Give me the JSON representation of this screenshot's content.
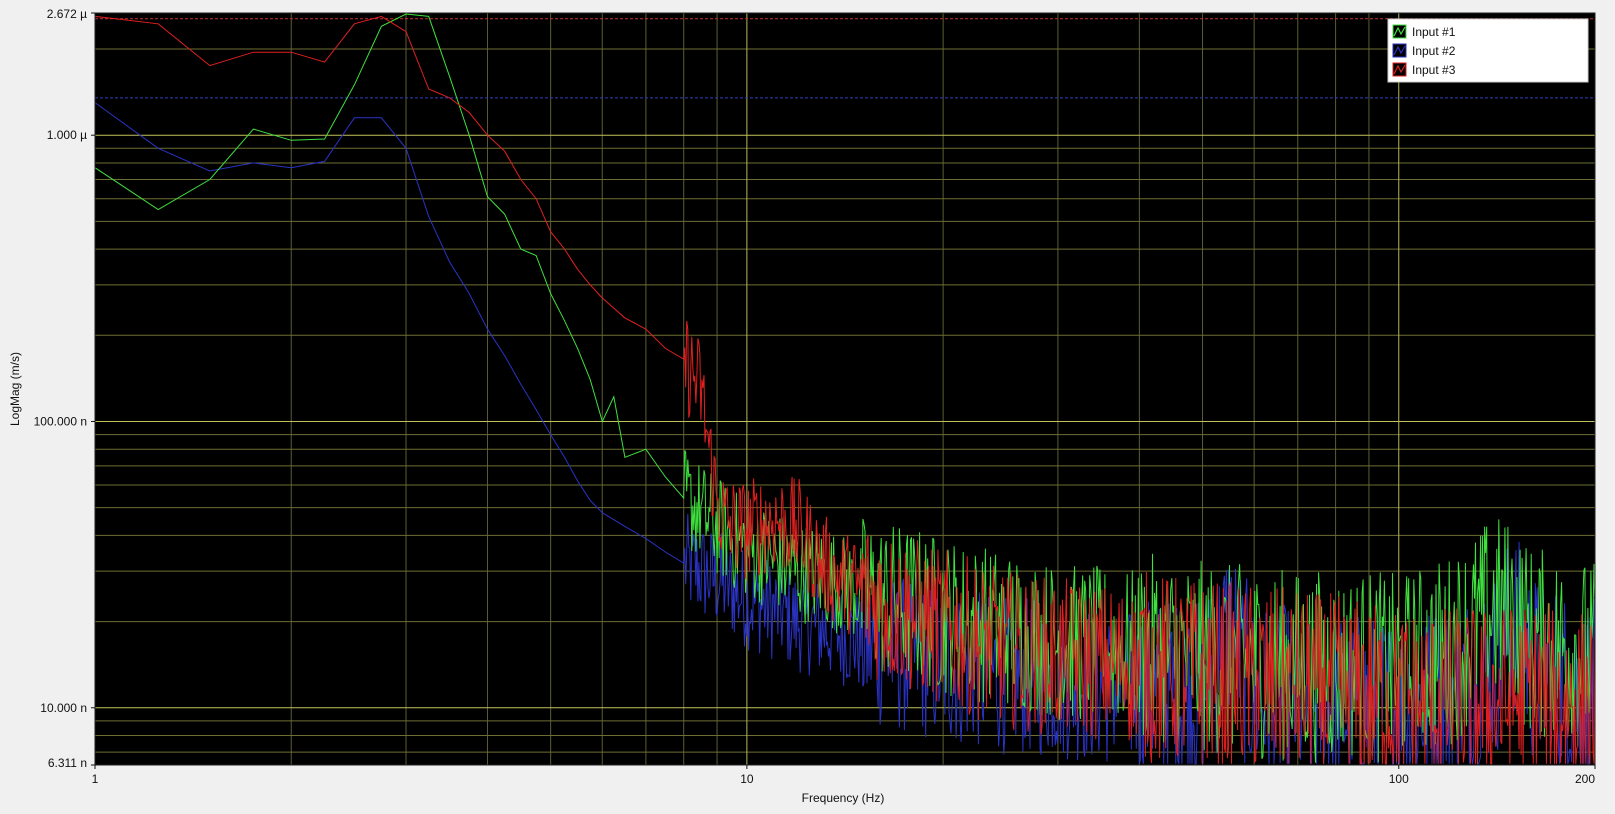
{
  "chart_data": {
    "type": "line",
    "title": "",
    "xlabel": "Frequency (Hz)",
    "ylabel": "LogMag (m/s)",
    "x_scale": "log",
    "y_scale": "log",
    "xlim": [
      1,
      200
    ],
    "ylim": [
      6.311e-09,
      2.672e-06
    ],
    "grid": true,
    "legend_position": "top-right",
    "background": "#000000",
    "x_ticks": [
      {
        "value": 1,
        "label": "1"
      },
      {
        "value": 10,
        "label": "10"
      },
      {
        "value": 100,
        "label": "100"
      },
      {
        "value": 200,
        "label": "200"
      }
    ],
    "y_ticks": [
      {
        "value": 2.672e-06,
        "label": "2.672 µ"
      },
      {
        "value": 1e-06,
        "label": "1.000 µ"
      },
      {
        "value": 1e-07,
        "label": "100.000 n"
      },
      {
        "value": 1e-08,
        "label": "10.000 n"
      },
      {
        "value": 6.311e-09,
        "label": "6.311 n"
      }
    ],
    "reference_lines": [
      {
        "color": "#c83030",
        "value": 2.55e-06
      },
      {
        "color": "#3040c0",
        "value": 1.35e-06
      }
    ],
    "series": [
      {
        "name": "Input #1",
        "color": "#3fe03f",
        "x": [
          1,
          1.25,
          1.5,
          1.75,
          2,
          2.25,
          2.5,
          2.75,
          3,
          3.25,
          3.5,
          3.75,
          4,
          4.25,
          4.5,
          4.75,
          5,
          5.25,
          5.5,
          5.75,
          6,
          6.25,
          6.5,
          7,
          7.5,
          8,
          8.5,
          9,
          9.5,
          10,
          11,
          12,
          13,
          14,
          15,
          16,
          18,
          20,
          25,
          30,
          40,
          50,
          60,
          70,
          80,
          90,
          100,
          120,
          140,
          150,
          160,
          180,
          200
        ],
        "y": [
          7.7e-07,
          5.5e-07,
          7e-07,
          1.05e-06,
          9.6e-07,
          9.7e-07,
          1.5e-06,
          2.4e-06,
          2.65e-06,
          2.6e-06,
          1.6e-06,
          1e-06,
          6.1e-07,
          5.3e-07,
          4e-07,
          3.8e-07,
          2.8e-07,
          2.25e-07,
          1.8e-07,
          1.4e-07,
          1e-07,
          1.22e-07,
          7.5e-08,
          8e-08,
          6.4e-08,
          5.4e-08,
          4.8e-08,
          4.3e-08,
          3.9e-08,
          3.6e-08,
          3.3e-08,
          3e-08,
          2.9e-08,
          2.7e-08,
          2.5e-08,
          2.4e-08,
          2.3e-08,
          2.1e-08,
          1.9e-08,
          1.7e-08,
          1.6e-08,
          1.5e-08,
          1.45e-08,
          1.4e-08,
          1.4e-08,
          1.4e-08,
          1.35e-08,
          1.6e-08,
          2.2e-08,
          2.1e-08,
          1.7e-08,
          1.6e-08,
          1.5e-08
        ]
      },
      {
        "name": "Input #2",
        "color": "#2a33c4",
        "x": [
          1,
          1.25,
          1.5,
          1.75,
          2,
          2.25,
          2.5,
          2.75,
          3,
          3.25,
          3.5,
          3.75,
          4,
          4.25,
          4.5,
          4.75,
          5,
          5.25,
          5.5,
          5.75,
          6,
          6.5,
          7,
          7.5,
          8,
          8.5,
          9,
          9.5,
          10,
          11,
          12,
          13,
          14,
          15,
          16,
          18,
          20,
          25,
          30,
          40,
          50,
          55,
          60,
          70,
          80,
          90,
          100,
          120,
          140,
          150,
          160,
          180,
          200
        ],
        "y": [
          1.3e-06,
          9e-07,
          7.5e-07,
          8e-07,
          7.7e-07,
          8.1e-07,
          1.15e-06,
          1.15e-06,
          9e-07,
          5.2e-07,
          3.6e-07,
          2.8e-07,
          2.1e-07,
          1.7e-07,
          1.35e-07,
          1.1e-07,
          9e-08,
          7.5e-08,
          6.2e-08,
          5.3e-08,
          4.8e-08,
          4.3e-08,
          3.9e-08,
          3.5e-08,
          3.2e-08,
          3e-08,
          2.8e-08,
          2.6e-08,
          2.4e-08,
          2.2e-08,
          2e-08,
          1.9e-08,
          1.8e-08,
          1.7e-08,
          1.6e-08,
          1.5e-08,
          1.4e-08,
          1.3e-08,
          1.25e-08,
          1.15e-08,
          1.1e-08,
          1.9e-08,
          1.1e-08,
          1.05e-08,
          1e-08,
          1e-08,
          1e-08,
          1.1e-08,
          1.4e-08,
          2e-08,
          1.4e-08,
          1.2e-08,
          1.1e-08
        ]
      },
      {
        "name": "Input #3",
        "color": "#e02020",
        "x": [
          1,
          1.25,
          1.5,
          1.75,
          2,
          2.25,
          2.5,
          2.75,
          3,
          3.25,
          3.5,
          3.75,
          4,
          4.25,
          4.5,
          4.75,
          5,
          5.25,
          5.5,
          5.75,
          6,
          6.5,
          7,
          7.5,
          8,
          8.5,
          8.75,
          9,
          9.25,
          9.5,
          10,
          11,
          12,
          13,
          14,
          15,
          16,
          18,
          20,
          25,
          30,
          40,
          50,
          60,
          70,
          80,
          90,
          100,
          120,
          140,
          160,
          180,
          200
        ],
        "y": [
          2.6e-06,
          2.45e-06,
          1.75e-06,
          1.95e-06,
          1.95e-06,
          1.8e-06,
          2.45e-06,
          2.6e-06,
          2.3e-06,
          1.45e-06,
          1.35e-06,
          1.2e-06,
          1e-06,
          8.8e-07,
          7e-07,
          6e-07,
          4.6e-07,
          4e-07,
          3.4e-07,
          3e-07,
          2.7e-07,
          2.3e-07,
          2.1e-07,
          1.8e-07,
          1.65e-07,
          1.3e-07,
          8e-08,
          5.2e-08,
          4.5e-08,
          4.3e-08,
          4.2e-08,
          4.5e-08,
          4.2e-08,
          3.2e-08,
          2.8e-08,
          2.6e-08,
          2.3e-08,
          2.1e-08,
          1.9e-08,
          1.6e-08,
          1.5e-08,
          1.4e-08,
          1.3e-08,
          1.25e-08,
          1.2e-08,
          1.15e-08,
          1.1e-08,
          1.05e-08,
          1.05e-08,
          1.05e-08,
          1.1e-08,
          1.05e-08,
          1e-08
        ]
      }
    ]
  }
}
